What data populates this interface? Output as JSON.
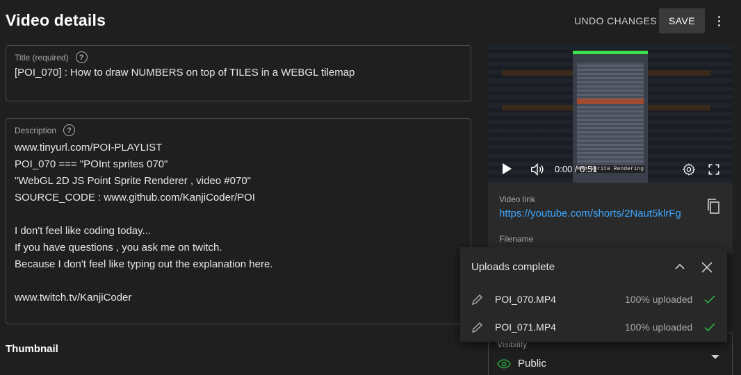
{
  "header": {
    "title": "Video details",
    "undo_label": "UNDO CHANGES",
    "save_label": "SAVE"
  },
  "title_field": {
    "label": "Title (required)",
    "value": "[POI_070] : How to draw NUMBERS on top of TILES in a WEBGL tilemap"
  },
  "description_field": {
    "label": "Description",
    "lines": [
      "www.tinyurl.com/POI-PLAYLIST",
      "POI_070 === \"POInt sprites 070\"",
      "\"WebGL 2D JS Point Sprite Renderer , video #070\"",
      "SOURCE_CODE : www.github.com/KanjiCoder/POI",
      "",
      "I don't feel like coding today...",
      "If you have questions , you ask me on twitch.",
      "Because I don't feel like typing out the explanation here.",
      "",
      "www.twitch.tv/KanjiCoder"
    ]
  },
  "thumbnail": {
    "label": "Thumbnail"
  },
  "video": {
    "time": "0:00 / 0:51",
    "caption": "MMO Sprite Rendering",
    "link_label": "Video link",
    "link_value": "https://youtube.com/shorts/2Naut5klrFg",
    "filename_label": "Filename"
  },
  "visibility": {
    "label": "Visibility",
    "value": "Public"
  },
  "uploads": {
    "title": "Uploads complete",
    "items": [
      {
        "filename": "POI_070.MP4",
        "status": "100% uploaded"
      },
      {
        "filename": "POI_071.MP4",
        "status": "100% uploaded"
      }
    ]
  },
  "colors": {
    "background": "#1f1f1f",
    "link": "#3ea6ff",
    "check": "#2ba640"
  }
}
